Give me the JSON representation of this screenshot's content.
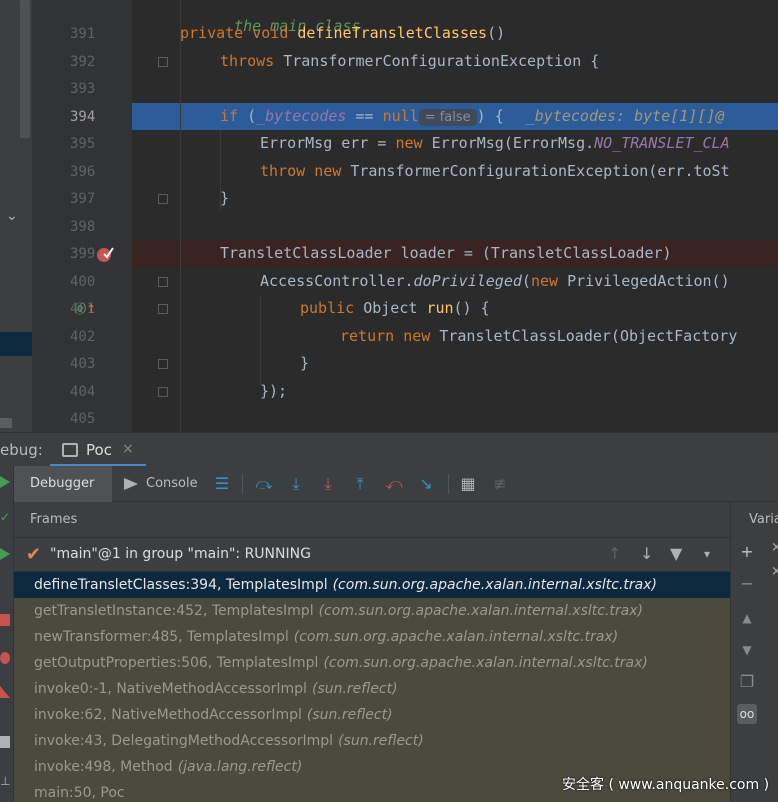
{
  "editor": {
    "comment_partial": "the main class",
    "lines": [
      {
        "num": "391",
        "tokens": [
          [
            "kw",
            "private "
          ],
          [
            "kw",
            "void "
          ],
          [
            "fn",
            "defineTransletClasses"
          ],
          [
            "cls",
            "()"
          ]
        ]
      },
      {
        "num": "392",
        "tokens": [
          [
            "kw",
            "throws "
          ],
          [
            "cls",
            "TransformerConfigurationException {"
          ]
        ]
      },
      {
        "num": "393",
        "tokens": []
      },
      {
        "num": "394",
        "tokens": [
          [
            "kw",
            "if "
          ],
          [
            "cls",
            "("
          ],
          [
            "field",
            "_bytecodes"
          ],
          [
            "cls",
            " == "
          ],
          [
            "kw",
            "null"
          ]
        ]
      },
      {
        "num": "395",
        "tokens": [
          [
            "cls",
            "ErrorMsg err = "
          ],
          [
            "kw",
            "new "
          ],
          [
            "cls",
            "ErrorMsg(ErrorMsg."
          ],
          [
            "field",
            "NO_TRANSLET_CLA"
          ]
        ]
      },
      {
        "num": "396",
        "tokens": [
          [
            "kw",
            "throw "
          ],
          [
            "kw",
            "new "
          ],
          [
            "cls",
            "TransformerConfigurationException(err.toSt"
          ]
        ]
      },
      {
        "num": "397",
        "tokens": [
          [
            "cls",
            "}"
          ]
        ]
      },
      {
        "num": "398",
        "tokens": []
      },
      {
        "num": "399",
        "tokens": [
          [
            "cls",
            "TransletClassLoader loader = (TransletClassLoader)"
          ]
        ]
      },
      {
        "num": "400",
        "tokens": [
          [
            "cls",
            "AccessController."
          ],
          [
            "italic",
            "doPrivileged"
          ],
          [
            "cls",
            "("
          ],
          [
            "kw",
            "new "
          ],
          [
            "cls",
            "PrivilegedAction()"
          ]
        ]
      },
      {
        "num": "401",
        "tokens": [
          [
            "kw",
            "public "
          ],
          [
            "cls",
            "Object "
          ],
          [
            "fn",
            "run"
          ],
          [
            "cls",
            "() {"
          ]
        ]
      },
      {
        "num": "402",
        "tokens": [
          [
            "kw",
            "return "
          ],
          [
            "kw",
            "new "
          ],
          [
            "cls",
            "TransletClassLoader(ObjectFactory"
          ]
        ]
      },
      {
        "num": "403",
        "tokens": [
          [
            "cls",
            "}"
          ]
        ]
      },
      {
        "num": "404",
        "tokens": [
          [
            "cls",
            "});"
          ]
        ]
      },
      {
        "num": "405",
        "tokens": []
      }
    ],
    "inline_hint": "= false",
    "line394_tail": ") {",
    "inline_debug_value": "_bytecodes: byte[1][]@"
  },
  "debug": {
    "label": "ebug:",
    "tab": "Poc",
    "tab_close": "×"
  },
  "toolbar": {
    "debugger": "Debugger",
    "console": "Console"
  },
  "frames": {
    "header": "Frames",
    "thread": "\"main\"@1 in group \"main\": RUNNING",
    "items": [
      {
        "method": "defineTransletClasses:394, TemplatesImpl",
        "pkg": "(com.sun.org.apache.xalan.internal.xsltc.trax)"
      },
      {
        "method": "getTransletInstance:452, TemplatesImpl",
        "pkg": "(com.sun.org.apache.xalan.internal.xsltc.trax)"
      },
      {
        "method": "newTransformer:485, TemplatesImpl",
        "pkg": "(com.sun.org.apache.xalan.internal.xsltc.trax)"
      },
      {
        "method": "getOutputProperties:506, TemplatesImpl",
        "pkg": "(com.sun.org.apache.xalan.internal.xsltc.trax)"
      },
      {
        "method": "invoke0:-1, NativeMethodAccessorImpl",
        "pkg": "(sun.reflect)"
      },
      {
        "method": "invoke:62, NativeMethodAccessorImpl",
        "pkg": "(sun.reflect)"
      },
      {
        "method": "invoke:43, DelegatingMethodAccessorImpl",
        "pkg": "(sun.reflect)"
      },
      {
        "method": "invoke:498, Method",
        "pkg": "(java.lang.reflect)"
      },
      {
        "method": "main:50, Poc",
        "pkg": ""
      }
    ]
  },
  "variables": {
    "label": "Varia"
  },
  "watermark": "安全客 ( www.anquanke.com )",
  "colors": {
    "accent": "#4a88c7",
    "selection": "#0d293e",
    "breakpoint": "#c75450"
  }
}
